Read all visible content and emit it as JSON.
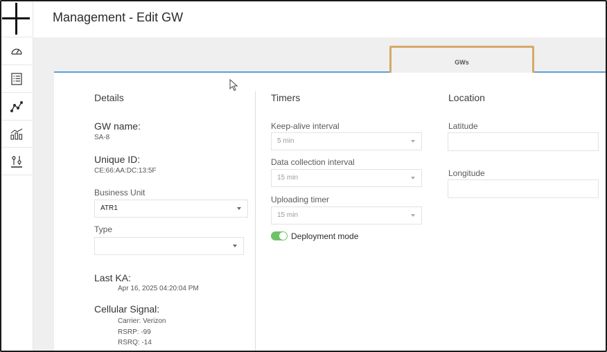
{
  "header": {
    "title": "Management - Edit GW"
  },
  "sidebar": {
    "items": [
      {
        "name": "dashboard",
        "icon": "speedometer-icon"
      },
      {
        "name": "list",
        "icon": "list-icon"
      },
      {
        "name": "trend",
        "icon": "line-graph-icon"
      },
      {
        "name": "analytics",
        "icon": "bar-chart-icon"
      },
      {
        "name": "management",
        "icon": "sliders-icon"
      }
    ]
  },
  "tabs": {
    "active_label": "GWs"
  },
  "details": {
    "title": "Details",
    "gw_name_label": "GW name:",
    "gw_name_value": "SA-8",
    "unique_id_label": "Unique ID:",
    "unique_id_value": "CE:66:AA:DC:13:5F",
    "business_unit_label": "Business Unit",
    "business_unit_value": "ATR1",
    "type_label": "Type",
    "type_value": "",
    "last_ka_label": "Last KA:",
    "last_ka_value": "Apr 16, 2025 04:20:04 PM",
    "cellular_label": "Cellular Signal:",
    "carrier": "Carrier: Verizon",
    "rsrp": "RSRP: -99",
    "rsrq": "RSRQ: -14"
  },
  "timers": {
    "title": "Timers",
    "keepalive_label": "Keep-alive interval",
    "keepalive_value": "5 min",
    "datacollection_label": "Data collection interval",
    "datacollection_value": "15 min",
    "uploading_label": "Uploading timer",
    "uploading_value": "15 min",
    "deployment_label": "Deployment mode",
    "deployment_on": true
  },
  "location": {
    "title": "Location",
    "latitude_label": "Latitude",
    "latitude_value": "",
    "longitude_label": "Longitude",
    "longitude_value": ""
  },
  "colors": {
    "accent_blue": "#5aa0d8",
    "highlight": "#d5a966",
    "toggle_green": "#6fc26a"
  }
}
